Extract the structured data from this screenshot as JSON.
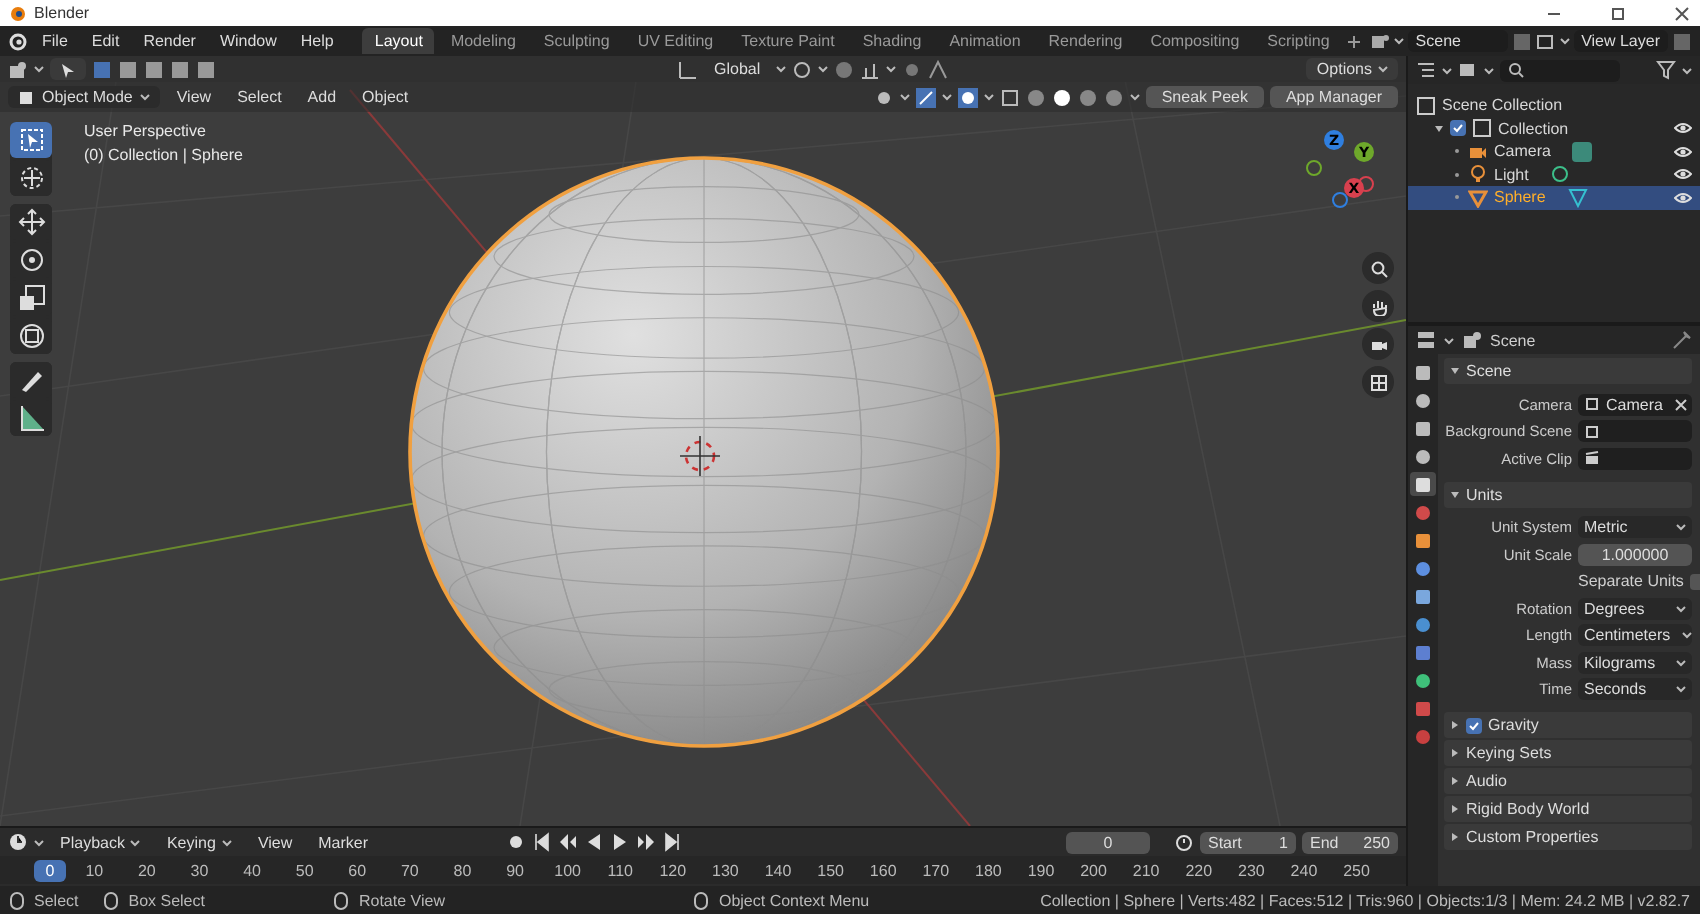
{
  "window": {
    "title": "Blender"
  },
  "menu": [
    "File",
    "Edit",
    "Render",
    "Window",
    "Help"
  ],
  "workspaces": [
    {
      "label": "Layout",
      "selected": true
    },
    {
      "label": "Modeling",
      "selected": false
    },
    {
      "label": "Sculpting",
      "selected": false
    },
    {
      "label": "UV Editing",
      "selected": false
    },
    {
      "label": "Texture Paint",
      "selected": false
    },
    {
      "label": "Shading",
      "selected": false
    },
    {
      "label": "Animation",
      "selected": false
    },
    {
      "label": "Rendering",
      "selected": false
    },
    {
      "label": "Compositing",
      "selected": false
    },
    {
      "label": "Scripting",
      "selected": false
    }
  ],
  "scene": "Scene",
  "view_layer": "View Layer",
  "viewport": {
    "orientation": "Global",
    "options": "Options",
    "mode": "Object Mode",
    "menus": [
      "View",
      "Select",
      "Add",
      "Object"
    ],
    "buttons": [
      "Sneak Peek",
      "App Manager"
    ],
    "overlay_lines": [
      "User Perspective",
      "(0) Collection | Sphere"
    ],
    "tool_groups": [
      [
        {
          "kind": "select",
          "selected": true
        },
        {
          "kind": "cursor",
          "selected": false
        }
      ],
      [
        {
          "kind": "move",
          "selected": false
        },
        {
          "kind": "rotate",
          "selected": false
        },
        {
          "kind": "scale",
          "selected": false
        },
        {
          "kind": "transform",
          "selected": false
        }
      ],
      [
        {
          "kind": "annotate",
          "selected": false
        },
        {
          "kind": "measure",
          "selected": false
        }
      ]
    ],
    "gizmo_axes": [
      {
        "label": "Z",
        "color": "#2f7fe0"
      },
      {
        "label": "Y",
        "color": "#6ea82b"
      },
      {
        "label": "X",
        "color": "#d8404e"
      }
    ]
  },
  "outliner": {
    "tree": [
      {
        "label": "Scene Collection",
        "kind": "scene_collection",
        "selected": false,
        "children": [
          {
            "label": "Collection",
            "kind": "collection",
            "checked": true,
            "selected": false,
            "expanded": true,
            "children": [
              {
                "label": "Camera",
                "kind": "camera",
                "selected": false
              },
              {
                "label": "Light",
                "kind": "light",
                "selected": false
              },
              {
                "label": "Sphere",
                "kind": "mesh",
                "selected": true
              }
            ]
          }
        ]
      }
    ]
  },
  "properties": {
    "context": "Scene",
    "tabs": [
      {
        "kind": "tool",
        "selected": false
      },
      {
        "kind": "render",
        "selected": false
      },
      {
        "kind": "output",
        "selected": false
      },
      {
        "kind": "view_layer",
        "selected": false
      },
      {
        "kind": "scene",
        "selected": true
      },
      {
        "kind": "world",
        "selected": false
      },
      {
        "kind": "object",
        "selected": false
      },
      {
        "kind": "modifiers",
        "selected": false
      },
      {
        "kind": "particles",
        "selected": false
      },
      {
        "kind": "physics",
        "selected": false
      },
      {
        "kind": "constraints",
        "selected": false
      },
      {
        "kind": "data",
        "selected": false
      },
      {
        "kind": "material",
        "selected": false
      },
      {
        "kind": "texture",
        "selected": false
      }
    ],
    "panels": [
      {
        "title": "Scene",
        "expanded": true,
        "rows": [
          {
            "kind": "object",
            "label": "Camera",
            "value": "Camera"
          },
          {
            "kind": "object",
            "label": "Background Scene"
          },
          {
            "kind": "clip",
            "label": "Active Clip"
          }
        ]
      },
      {
        "title": "Units",
        "expanded": true,
        "rows": [
          {
            "kind": "select",
            "label": "Unit System",
            "value": "Metric"
          },
          {
            "kind": "number",
            "label": "Unit Scale",
            "value": "1.000000"
          },
          {
            "kind": "checkbox",
            "label": "Separate Units",
            "checked": false
          },
          {
            "kind": "select",
            "label": "Rotation",
            "value": "Degrees"
          },
          {
            "kind": "select",
            "label": "Length",
            "value": "Centimeters"
          },
          {
            "kind": "select",
            "label": "Mass",
            "value": "Kilograms"
          },
          {
            "kind": "select",
            "label": "Time",
            "value": "Seconds"
          }
        ]
      },
      {
        "title": "Gravity",
        "expanded": false,
        "checked": true
      },
      {
        "title": "Keying Sets",
        "expanded": false
      },
      {
        "title": "Audio",
        "expanded": false
      },
      {
        "title": "Rigid Body World",
        "expanded": false
      },
      {
        "title": "Custom Properties",
        "expanded": false
      }
    ]
  },
  "timeline": {
    "menus": [
      "Playback",
      "Keying",
      "View",
      "Marker"
    ],
    "current_frame": "0",
    "start_label": "Start",
    "start": "1",
    "end_label": "End",
    "end": "250",
    "playhead": "0",
    "ruler": [
      "10",
      "20",
      "30",
      "40",
      "50",
      "60",
      "70",
      "80",
      "90",
      "100",
      "110",
      "120",
      "130",
      "140",
      "150",
      "160",
      "170",
      "180",
      "190",
      "200",
      "210",
      "220",
      "230",
      "240",
      "250"
    ]
  },
  "status": {
    "hints": [
      "Select",
      "Box Select",
      "Rotate View",
      "Object Context Menu"
    ],
    "stats": "Collection | Sphere | Verts:482 | Faces:512 | Tris:960 | Objects:1/3 | Mem: 24.2 MB | v2.82.7"
  }
}
